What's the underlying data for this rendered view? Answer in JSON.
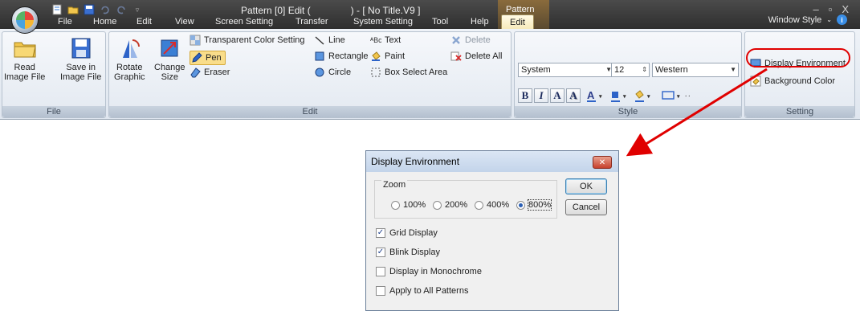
{
  "window": {
    "title": "Pattern [0] Edit (               ) - [ No Title.V9 ]",
    "context_tab_group": "Pattern",
    "minimize": "–",
    "maximize": "▫",
    "close": "X"
  },
  "tabs": [
    "File",
    "Home",
    "Edit",
    "View",
    "Screen Setting",
    "Transfer",
    "System Setting",
    "Tool",
    "Help",
    "Edit"
  ],
  "window_style": "Window Style",
  "ribbon": {
    "file_group": {
      "label": "File",
      "read": "Read\nImage File",
      "save": "Save in\nImage File"
    },
    "edit_group": {
      "label": "Edit",
      "rotate": "Rotate\nGraphic",
      "change_size": "Change\nSize",
      "transparent": "Transparent Color Setting",
      "pen": "Pen",
      "eraser": "Eraser",
      "line": "Line",
      "rectangle": "Rectangle",
      "circle": "Circle",
      "text": "Text",
      "paint": "Paint",
      "box_select": "Box Select Area",
      "delete": "Delete",
      "delete_all": "Delete All"
    },
    "style_group": {
      "label": "Style",
      "font": "System",
      "size": "12",
      "charset": "Western",
      "bold": "B",
      "italic": "I",
      "boxA": "A",
      "shadowA": "A"
    },
    "setting_group": {
      "label": "Setting",
      "display_env": "Display Environment",
      "background": "Background Color"
    }
  },
  "dialog": {
    "title": "Display Environment",
    "zoom_label": "Zoom",
    "zoom_options": [
      "100%",
      "200%",
      "400%",
      "800%"
    ],
    "zoom_selected": "800%",
    "ok": "OK",
    "cancel": "Cancel",
    "checkboxes": [
      {
        "label": "Grid Display",
        "checked": true
      },
      {
        "label": "Blink Display",
        "checked": true
      },
      {
        "label": "Display in Monochrome",
        "checked": false
      },
      {
        "label": "Apply to All Patterns",
        "checked": false
      }
    ]
  },
  "colors": {
    "highlight": "#e00000",
    "titlebar": "#3a3a3a",
    "ribbon": "#e3e9f1"
  }
}
